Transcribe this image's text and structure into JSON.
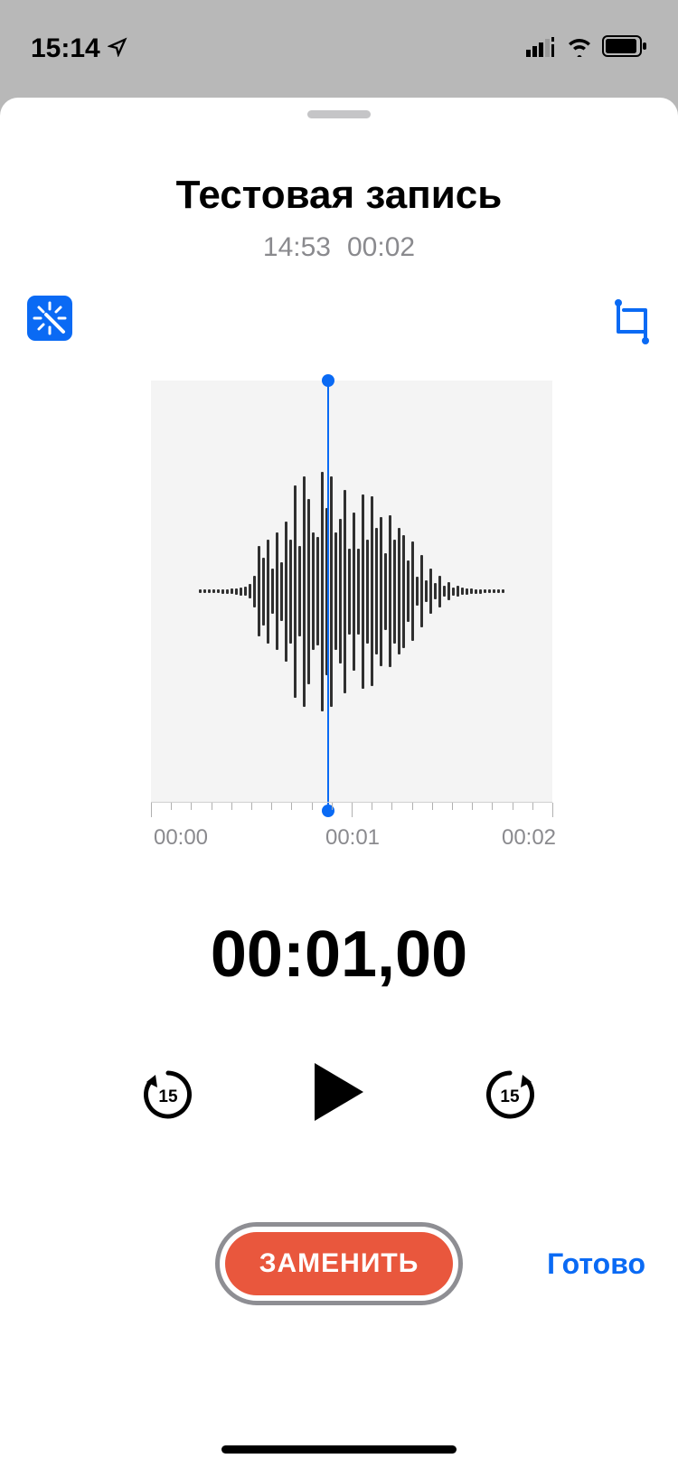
{
  "status": {
    "time": "15:14",
    "location_icon": "location-arrow"
  },
  "recording": {
    "title": "Тестовая запись",
    "time_created": "14:53",
    "duration": "00:02"
  },
  "timeline": {
    "labels": [
      "00:00",
      "00:01",
      "00:02"
    ]
  },
  "playback": {
    "position": "00:01,00",
    "skip_seconds": "15"
  },
  "actions": {
    "replace": "ЗАМЕНИТЬ",
    "done": "Готово"
  },
  "waveform": {
    "bars": [
      4,
      4,
      4,
      4,
      4,
      5,
      5,
      6,
      7,
      9,
      10,
      16,
      35,
      100,
      75,
      115,
      50,
      130,
      65,
      155,
      115,
      235,
      100,
      255,
      205,
      130,
      120,
      265,
      185,
      255,
      130,
      160,
      225,
      95,
      175,
      95,
      215,
      115,
      210,
      140,
      165,
      85,
      168,
      115,
      140,
      125,
      68,
      110,
      32,
      80,
      24,
      50,
      18,
      35,
      12,
      20,
      9,
      12,
      8,
      7,
      6,
      5,
      5,
      4,
      4,
      4,
      4,
      4
    ]
  }
}
